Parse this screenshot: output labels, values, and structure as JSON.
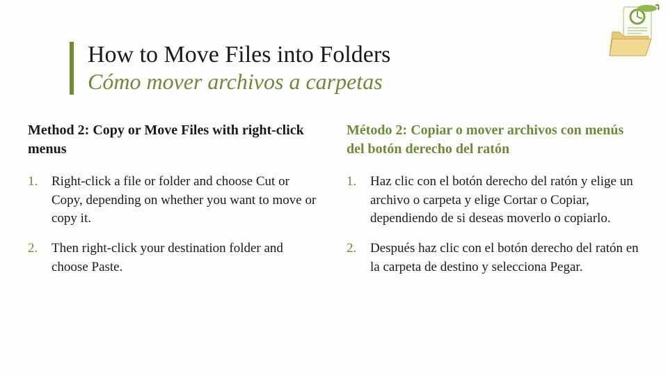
{
  "header": {
    "title_en": "How to Move Files into Folders",
    "title_es": "Cómo mover archivos a carpetas"
  },
  "left": {
    "heading": "Method 2: Copy or Move Files with right-click menus",
    "steps": [
      "Right-click a file or folder and choose Cut or Copy, depending on whether you want to move or copy it.",
      "Then right-click your destination folder and choose Paste."
    ]
  },
  "right": {
    "heading": "Método 2: Copiar o mover archivos con menús del botón derecho del ratón",
    "steps": [
      "Haz clic con el botón derecho del ratón y elige un archivo o carpeta y elige Cortar o Copiar, dependiendo de si deseas moverlo o copiarlo.",
      "Después haz clic con el botón derecho del ratón en la carpeta de destino y selecciona Pegar."
    ]
  },
  "icon": "folder-document-icon"
}
